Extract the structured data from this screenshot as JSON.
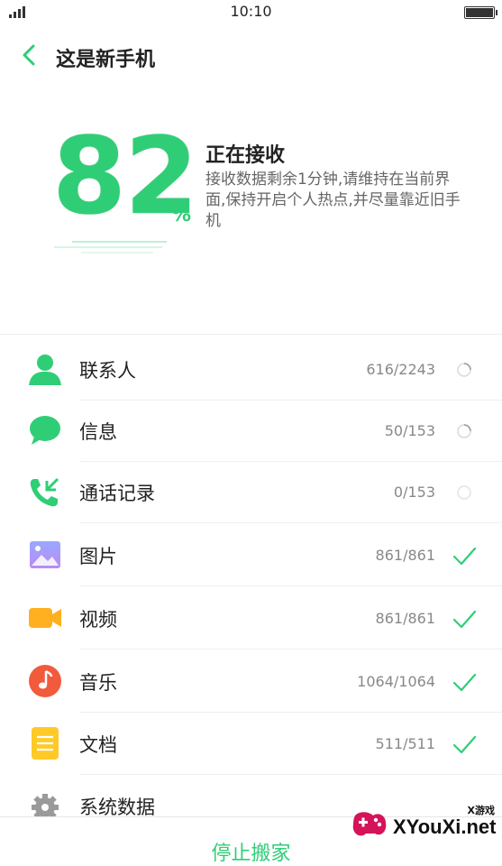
{
  "status_bar": {
    "time": "10:10"
  },
  "header": {
    "title": "这是新手机"
  },
  "progress": {
    "value": "82",
    "unit": "%",
    "title": "正在接收",
    "description": "接收数据剩余1分钟,请维持在当前界面,保持开启个人热点,并尽量靠近旧手机"
  },
  "items": [
    {
      "label": "联系人",
      "count": "616/2243",
      "state": "loading",
      "icon": "contact-icon"
    },
    {
      "label": "信息",
      "count": "50/153",
      "state": "loading",
      "icon": "message-icon"
    },
    {
      "label": "通话记录",
      "count": "0/153",
      "state": "pending",
      "icon": "call-log-icon"
    },
    {
      "label": "图片",
      "count": "861/861",
      "state": "done",
      "icon": "picture-icon"
    },
    {
      "label": "视频",
      "count": "861/861",
      "state": "done",
      "icon": "video-icon"
    },
    {
      "label": "音乐",
      "count": "1064/1064",
      "state": "done",
      "icon": "music-icon"
    },
    {
      "label": "文档",
      "count": "511/511",
      "state": "done",
      "icon": "document-icon"
    },
    {
      "label": "系统数据",
      "count": "",
      "state": "",
      "icon": "gear-icon"
    }
  ],
  "footer": {
    "stop_label": "停止搬家"
  },
  "watermark": {
    "text": "XYouXi.net",
    "tag": "X游戏"
  },
  "colors": {
    "accent": "#2fce76"
  }
}
